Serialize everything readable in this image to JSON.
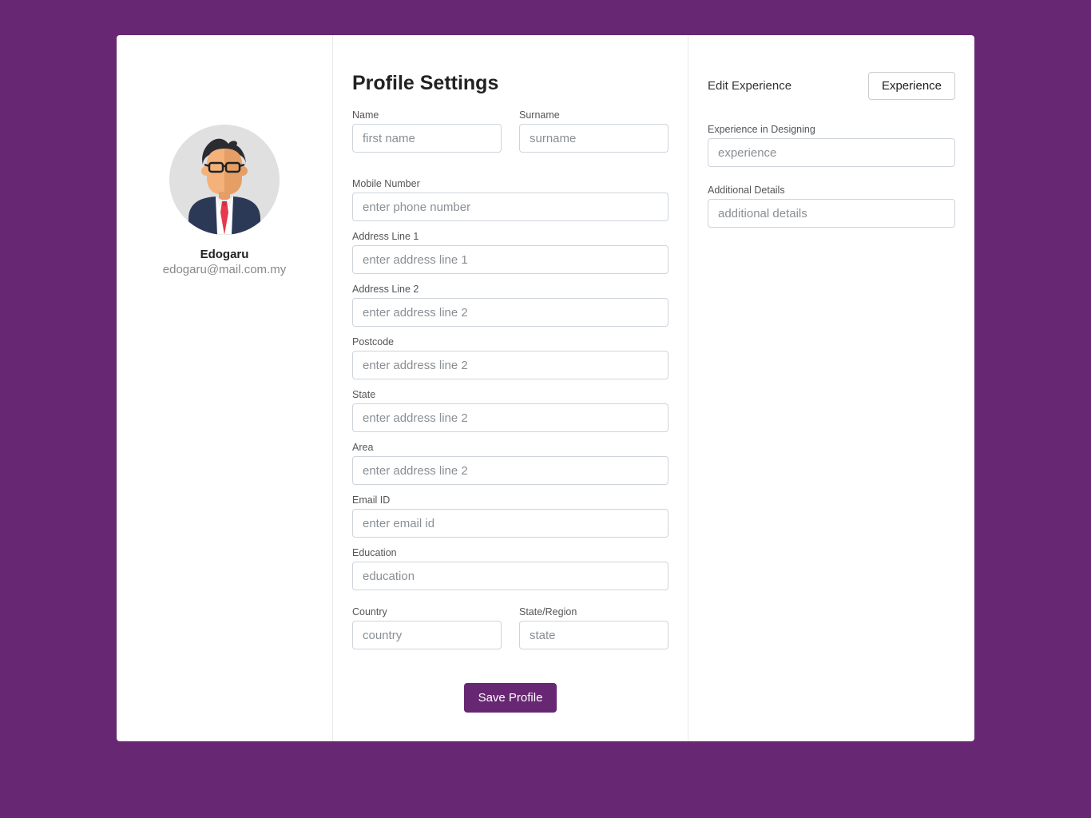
{
  "profile": {
    "username": "Edogaru",
    "email": "edogaru@mail.com.my"
  },
  "settings": {
    "title": "Profile Settings",
    "name": {
      "label": "Name",
      "placeholder": "first name",
      "value": ""
    },
    "surname": {
      "label": "Surname",
      "placeholder": "surname",
      "value": ""
    },
    "mobile": {
      "label": "Mobile Number",
      "placeholder": "enter phone number",
      "value": ""
    },
    "address1": {
      "label": "Address Line 1",
      "placeholder": "enter address line 1",
      "value": ""
    },
    "address2": {
      "label": "Address Line 2",
      "placeholder": "enter address line 2",
      "value": ""
    },
    "postcode": {
      "label": "Postcode",
      "placeholder": "enter address line 2",
      "value": ""
    },
    "state": {
      "label": "State",
      "placeholder": "enter address line 2",
      "value": ""
    },
    "area": {
      "label": "Area",
      "placeholder": "enter address line 2",
      "value": ""
    },
    "emailid": {
      "label": "Email ID",
      "placeholder": "enter email id",
      "value": ""
    },
    "education": {
      "label": "Education",
      "placeholder": "education",
      "value": ""
    },
    "country": {
      "label": "Country",
      "placeholder": "country",
      "value": ""
    },
    "stateRegion": {
      "label": "State/Region",
      "placeholder": "state",
      "value": ""
    },
    "save_label": "Save Profile"
  },
  "experience": {
    "edit_title": "Edit Experience",
    "button_label": "Experience",
    "design": {
      "label": "Experience in Designing",
      "placeholder": "experience",
      "value": ""
    },
    "additional": {
      "label": "Additional Details",
      "placeholder": "additional details",
      "value": ""
    }
  }
}
